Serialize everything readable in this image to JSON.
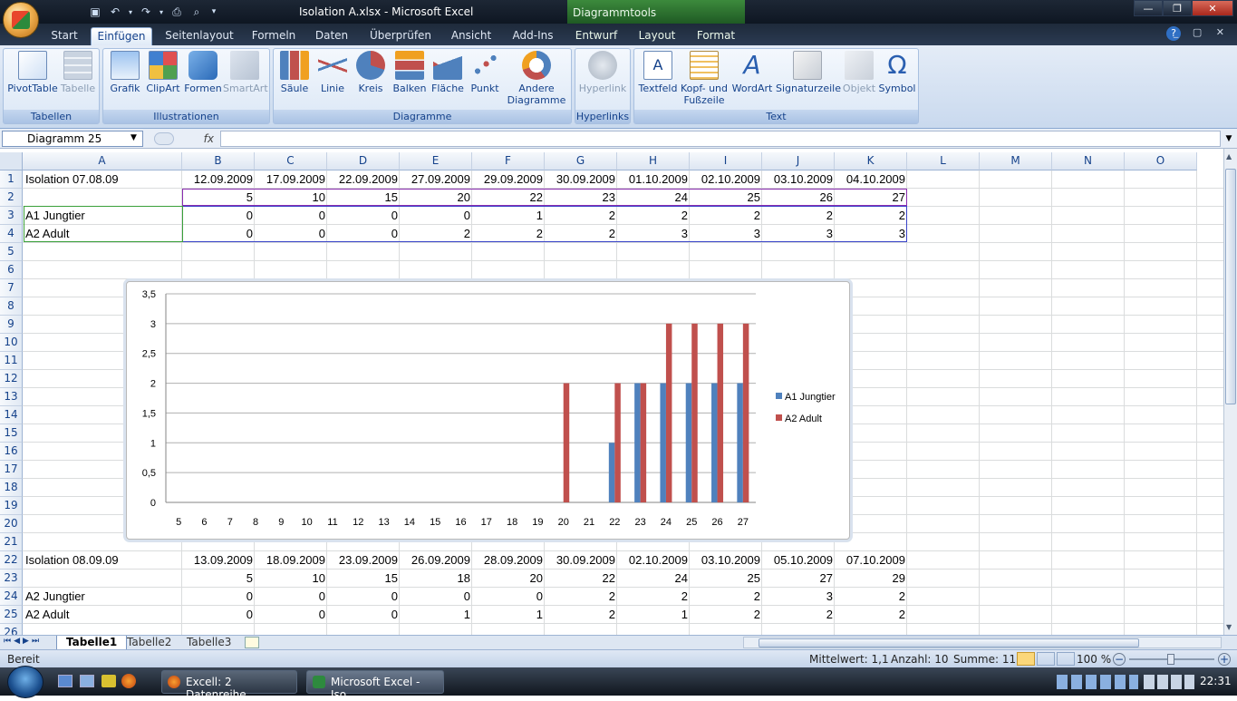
{
  "window": {
    "title": "Isolation A.xlsx - Microsoft Excel",
    "context_title": "Diagrammtools",
    "controls": [
      "—",
      "❐",
      "✕"
    ]
  },
  "ribbon_tabs": [
    {
      "label": "Start",
      "active": false
    },
    {
      "label": "Einfügen",
      "active": true
    },
    {
      "label": "Seitenlayout",
      "active": false
    },
    {
      "label": "Formeln",
      "active": false
    },
    {
      "label": "Daten",
      "active": false
    },
    {
      "label": "Überprüfen",
      "active": false
    },
    {
      "label": "Ansicht",
      "active": false
    },
    {
      "label": "Add-Ins",
      "active": false
    },
    {
      "label": "Entwurf",
      "active": false
    },
    {
      "label": "Layout",
      "active": false
    },
    {
      "label": "Format",
      "active": false
    }
  ],
  "ribbon_groups": [
    {
      "label": "Tabellen",
      "buttons": [
        {
          "label": "PivotTable",
          "icon": "pivottable-icon",
          "enabled": true
        },
        {
          "label": "Tabelle",
          "icon": "table-icon",
          "enabled": false
        }
      ]
    },
    {
      "label": "Illustrationen",
      "buttons": [
        {
          "label": "Grafik",
          "icon": "picture-icon",
          "enabled": true
        },
        {
          "label": "ClipArt",
          "icon": "clipart-icon",
          "enabled": true
        },
        {
          "label": "Formen",
          "icon": "shapes-icon",
          "enabled": true
        },
        {
          "label": "SmartArt",
          "icon": "smartart-icon",
          "enabled": false
        }
      ]
    },
    {
      "label": "Diagramme",
      "buttons": [
        {
          "label": "Säule",
          "icon": "column-chart-icon",
          "enabled": true
        },
        {
          "label": "Linie",
          "icon": "line-chart-icon",
          "enabled": true
        },
        {
          "label": "Kreis",
          "icon": "pie-chart-icon",
          "enabled": true
        },
        {
          "label": "Balken",
          "icon": "bar-chart-icon",
          "enabled": true
        },
        {
          "label": "Fläche",
          "icon": "area-chart-icon",
          "enabled": true
        },
        {
          "label": "Punkt",
          "icon": "scatter-chart-icon",
          "enabled": true
        },
        {
          "label": "Andere Diagramme",
          "icon": "other-charts-icon",
          "enabled": true
        }
      ]
    },
    {
      "label": "Hyperlinks",
      "buttons": [
        {
          "label": "Hyperlink",
          "icon": "hyperlink-icon",
          "enabled": false
        }
      ]
    },
    {
      "label": "Text",
      "buttons": [
        {
          "label": "Textfeld",
          "icon": "textbox-icon",
          "enabled": true
        },
        {
          "label": "Kopf- und Fußzeile",
          "icon": "header-footer-icon",
          "enabled": true
        },
        {
          "label": "WordArt",
          "icon": "wordart-icon",
          "enabled": true
        },
        {
          "label": "Signaturzeile",
          "icon": "signature-icon",
          "enabled": true
        },
        {
          "label": "Objekt",
          "icon": "object-icon",
          "enabled": false
        },
        {
          "label": "Symbol",
          "icon": "omega-icon",
          "enabled": true
        }
      ]
    }
  ],
  "formula_bar": {
    "name_box": "Diagramm 25",
    "fx": "fx",
    "formula": ""
  },
  "columns": [
    "A",
    "B",
    "C",
    "D",
    "E",
    "F",
    "G",
    "H",
    "I",
    "J",
    "K",
    "L",
    "M",
    "N",
    "O"
  ],
  "rows": [
    "1",
    "2",
    "3",
    "4",
    "5",
    "6",
    "7",
    "8",
    "9",
    "10",
    "11",
    "12",
    "13",
    "14",
    "15",
    "16",
    "17",
    "18",
    "19",
    "20",
    "21",
    "22",
    "23",
    "24",
    "25",
    "26"
  ],
  "cells": {
    "r1": [
      "Isolation 07.08.09",
      "12.09.2009",
      "17.09.2009",
      "22.09.2009",
      "27.09.2009",
      "29.09.2009",
      "30.09.2009",
      "01.10.2009",
      "02.10.2009",
      "03.10.2009",
      "04.10.2009"
    ],
    "r2": [
      "",
      "5",
      "10",
      "15",
      "20",
      "22",
      "23",
      "24",
      "25",
      "26",
      "27"
    ],
    "r3": [
      "A1 Jungtier",
      "0",
      "0",
      "0",
      "0",
      "1",
      "2",
      "2",
      "2",
      "2",
      "2"
    ],
    "r4": [
      "A2 Adult",
      "0",
      "0",
      "0",
      "2",
      "2",
      "2",
      "3",
      "3",
      "3",
      "3"
    ],
    "r22": [
      "Isolation 08.09.09",
      "13.09.2009",
      "18.09.2009",
      "23.09.2009",
      "26.09.2009",
      "28.09.2009",
      "30.09.2009",
      "02.10.2009",
      "03.10.2009",
      "05.10.2009",
      "07.10.2009"
    ],
    "r23": [
      "",
      "5",
      "10",
      "15",
      "18",
      "20",
      "22",
      "24",
      "25",
      "27",
      "29"
    ],
    "r24": [
      "A2 Jungtier",
      "0",
      "0",
      "0",
      "0",
      "0",
      "2",
      "2",
      "2",
      "3",
      "2"
    ],
    "r25": [
      "A2 Adult",
      "0",
      "0",
      "0",
      "1",
      "1",
      "2",
      "1",
      "2",
      "2",
      "2"
    ]
  },
  "chart_data": {
    "type": "bar",
    "categories": [
      "5",
      "6",
      "7",
      "8",
      "9",
      "10",
      "11",
      "12",
      "13",
      "14",
      "15",
      "16",
      "17",
      "18",
      "19",
      "20",
      "21",
      "22",
      "23",
      "24",
      "25",
      "26",
      "27"
    ],
    "series": [
      {
        "name": "A1 Jungtier",
        "color": "#4f81bd",
        "values": [
          0,
          0,
          0,
          0,
          0,
          0,
          0,
          0,
          0,
          0,
          0,
          0,
          0,
          0,
          0,
          0,
          0,
          1,
          2,
          2,
          2,
          2,
          2
        ]
      },
      {
        "name": "A2 Adult",
        "color": "#c0504d",
        "values": [
          0,
          0,
          0,
          0,
          0,
          0,
          0,
          0,
          0,
          0,
          0,
          0,
          0,
          0,
          0,
          2,
          0,
          2,
          2,
          3,
          3,
          3,
          3
        ]
      }
    ],
    "yticks": [
      "0",
      "0,5",
      "1",
      "1,5",
      "2",
      "2,5",
      "3",
      "3,5"
    ],
    "ylim": [
      0,
      3.5
    ],
    "grid": true,
    "legend": "right"
  },
  "sheet_tabs": [
    {
      "label": "Tabelle1",
      "active": true
    },
    {
      "label": "Tabelle2",
      "active": false
    },
    {
      "label": "Tabelle3",
      "active": false
    }
  ],
  "status": {
    "mode": "Bereit",
    "average": "Mittelwert: 1,1",
    "count": "Anzahl: 10",
    "sum": "Summe: 11",
    "zoom": "100 %"
  },
  "taskbar": {
    "tasks": [
      "Excell: 2 Datenreihe...",
      "Microsoft Excel - Iso..."
    ],
    "clock": "22:31"
  }
}
